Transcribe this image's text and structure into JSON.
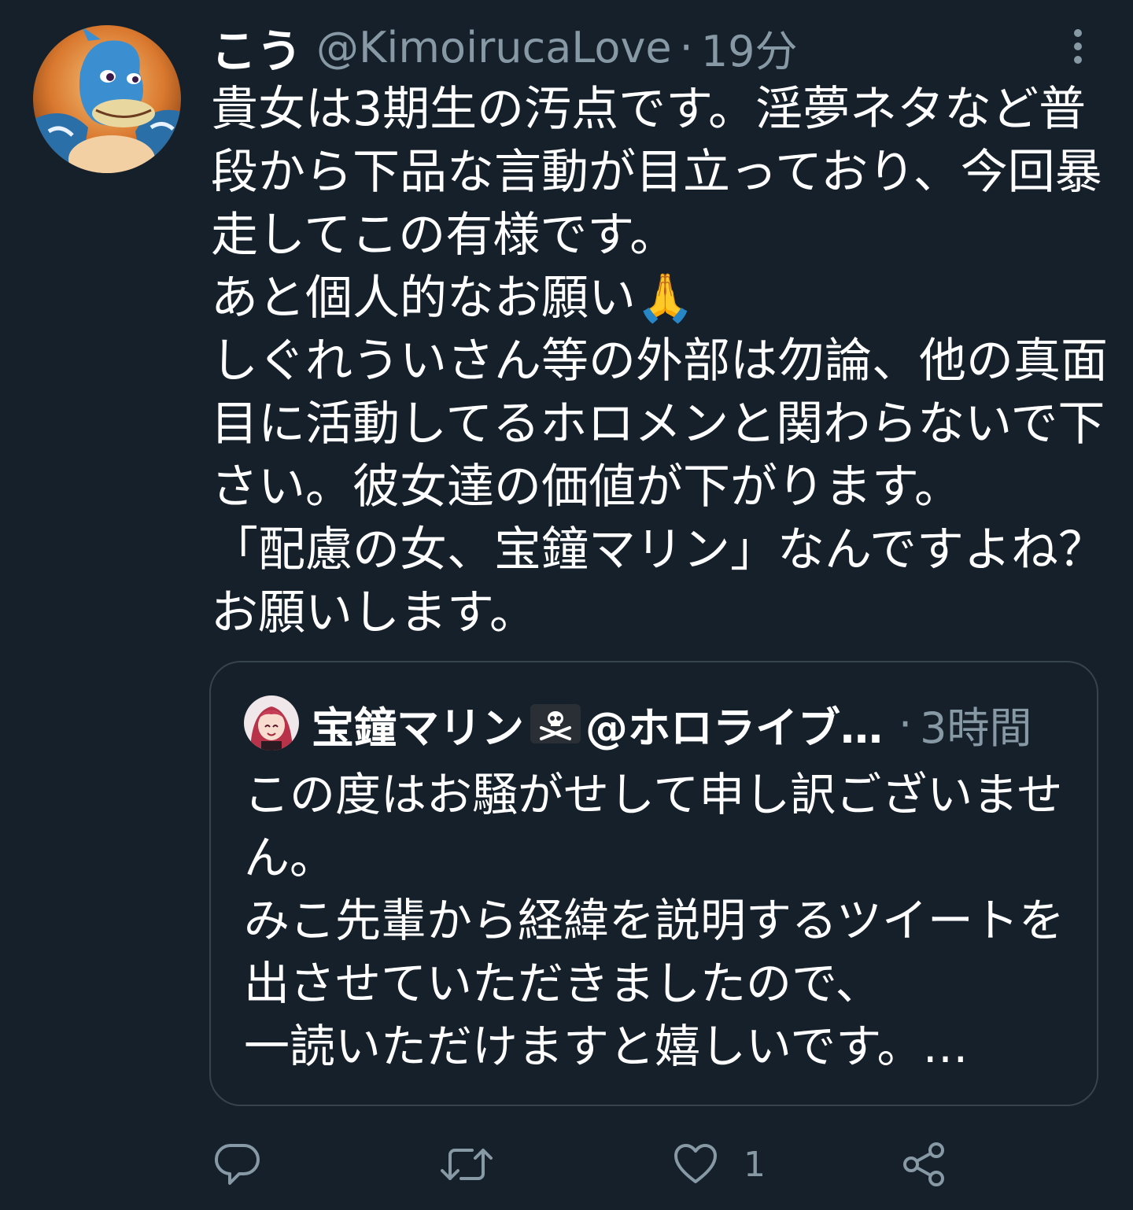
{
  "tweet": {
    "display_name": "こう",
    "handle": "@KimoirucaLove",
    "separator": "·",
    "time": "19分",
    "avatar_icon": "user-avatar",
    "text_lines": [
      "貴女は3期生の汚点です。淫夢ネタなど普",
      "段から下品な言動が目立っており、今回暴",
      "走してこの有様です。",
      "あと個人的なお願い🙏",
      "しぐれういさん等の外部は勿論、他の真面",
      "目に活動してるホロメンと関わらないで下",
      "さい。彼女達の価値が下がります。",
      "「配慮の女、宝鐘マリン」なんですよね？",
      "お願いします。"
    ]
  },
  "quoted_tweet": {
    "display_name": "宝鐘マリン",
    "name_emoji": "☠",
    "handle": "@ホロライブ…",
    "separator": "·",
    "time": "3時間",
    "text_lines": [
      "この度はお騒がせして申し訳ございませ",
      "ん。",
      "みこ先輩から経緯を説明するツイートを",
      "出させていただきましたので、",
      "一読いただけますと嬉しいです。…"
    ]
  },
  "actions": {
    "reply_icon": "reply-icon",
    "retweet_icon": "retweet-icon",
    "like_icon": "like-icon",
    "like_count": "1",
    "share_icon": "share-icon"
  },
  "colors": {
    "background": "#15202b",
    "text": "#ffffff",
    "secondary": "#8899a6",
    "border": "#38444d"
  }
}
